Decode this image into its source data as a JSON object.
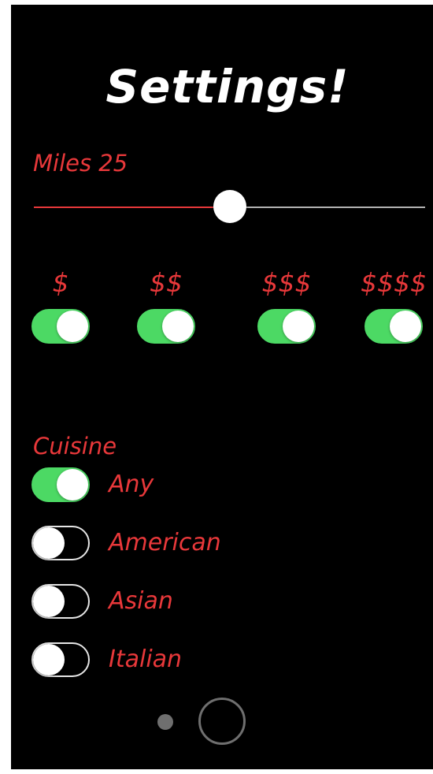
{
  "header": {
    "title": "Settings!"
  },
  "distance": {
    "label": "Miles 25",
    "slider_value_fraction": 0.5
  },
  "price_levels": [
    {
      "label": "$",
      "on": true
    },
    {
      "label": "$$",
      "on": true
    },
    {
      "label": "$$$",
      "on": true
    },
    {
      "label": "$$$$",
      "on": true
    }
  ],
  "cuisine": {
    "label": "Cuisine",
    "options": [
      {
        "label": "Any",
        "on": true
      },
      {
        "label": "American",
        "on": false
      },
      {
        "label": "Asian",
        "on": false
      },
      {
        "label": "Italian",
        "on": false
      }
    ]
  },
  "page_control": {
    "pages": 2,
    "current_page": 2
  },
  "colors": {
    "accent": "#e8383a",
    "switch_on": "#4cd964",
    "background": "#000000",
    "title": "#ffffff"
  }
}
